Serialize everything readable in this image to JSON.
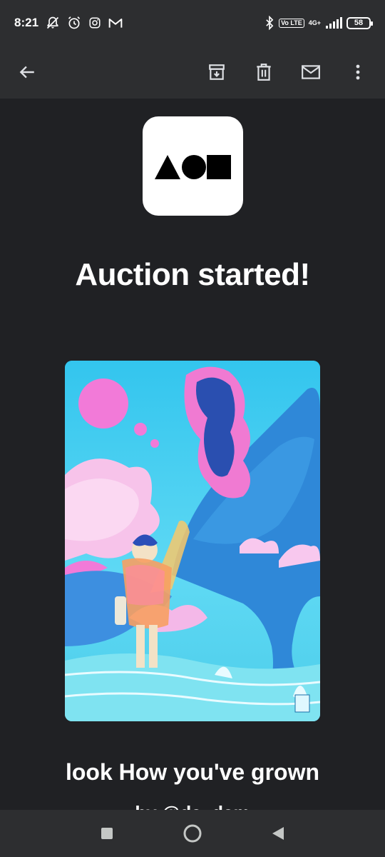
{
  "status_bar": {
    "time": "8:21",
    "battery": "58",
    "volte": "Vo LTE",
    "network": "4G+",
    "icons": [
      "mute-notifications-icon",
      "alarm-icon",
      "instagram-icon",
      "gmail-icon",
      "bluetooth-icon",
      "signal-icon",
      "battery-icon"
    ]
  },
  "toolbar": {
    "back_icon": "arrow-back-icon",
    "archive_icon": "archive-icon",
    "delete_icon": "trash-icon",
    "mark_unread_icon": "mail-icon",
    "more_icon": "more-vertical-icon"
  },
  "email": {
    "logo_icon": "foundation-logo-icon",
    "headline": "Auction started!",
    "artwork_title": "look How you've grown",
    "by_prefix": "by ",
    "artist_handle": "@da_dam"
  },
  "nav_bar": {
    "recents_icon": "square-recents-icon",
    "home_icon": "circle-home-icon",
    "back_icon": "triangle-back-icon"
  },
  "colors": {
    "background": "#202124",
    "bar": "#2d2e30",
    "text": "#ffffff",
    "art_cyan": "#37c8ee",
    "art_pink": "#f27ad8"
  }
}
